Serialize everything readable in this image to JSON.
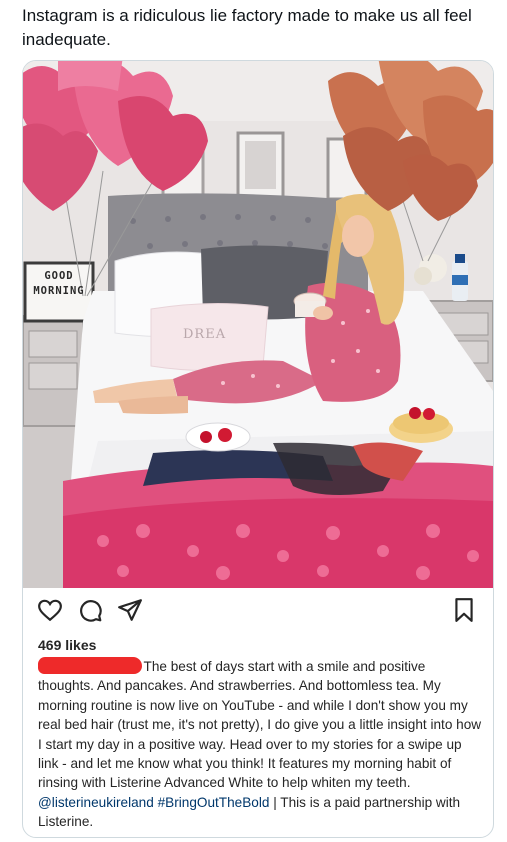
{
  "tweet": {
    "text": "Instagram is a ridiculous lie factory made to make us all feel inadequate."
  },
  "post": {
    "image_sign": {
      "line1": "GOOD",
      "line2": "MORNING"
    },
    "pillow_text": "DREA",
    "likes": "469 likes",
    "caption": {
      "body": "The best of days start with a smile and positive thoughts. And pancakes. And strawberries. And bottomless tea. My morning routine is now live on YouTube - and while I don't show you my real bed hair (trust me, it's not pretty), I do give you a little insight into how I start my day in a positive way. Head over to my stories for a swipe up link - and let me know what you think! It features my morning habit of rinsing with Listerine Advanced White to help whiten my teeth.",
      "mention": "@listerineukireland",
      "hashtag": "#BringOutTheBold",
      "tail": "| This is a paid partnership with Listerine."
    },
    "icons": [
      "heart-icon",
      "comment-icon",
      "share-icon",
      "bookmark-icon"
    ]
  }
}
